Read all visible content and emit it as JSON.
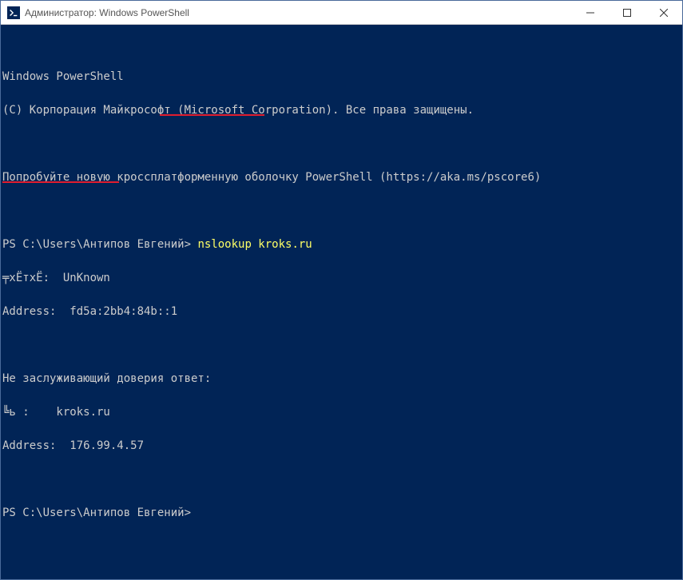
{
  "titlebar": {
    "title": "Администратор: Windows PowerShell"
  },
  "terminal": {
    "lines": {
      "l1": "Windows PowerShell",
      "l2": "(C) Корпорация Майкрософт (Microsoft Corporation). Все права защищены.",
      "l3": "",
      "l4": "Попробуйте новую кроссплатформенную оболочку PowerShell (https://aka.ms/pscore6)",
      "l5": "",
      "prompt1_prefix": "PS C:\\Users\\Антипов Евгений> ",
      "prompt1_cmd": "nslookup kroks.ru",
      "l7": "╤хЁтхЁ:  UnKnown",
      "l8": "Address:  fd5a:2bb4:84b::1",
      "l9": "",
      "l10": "Не заслуживающий доверия ответ:",
      "l11": "╚ь :    kroks.ru",
      "l12": "Address:  176.99.4.57",
      "l13": "",
      "prompt2": "PS C:\\Users\\Антипов Евгений>"
    }
  }
}
